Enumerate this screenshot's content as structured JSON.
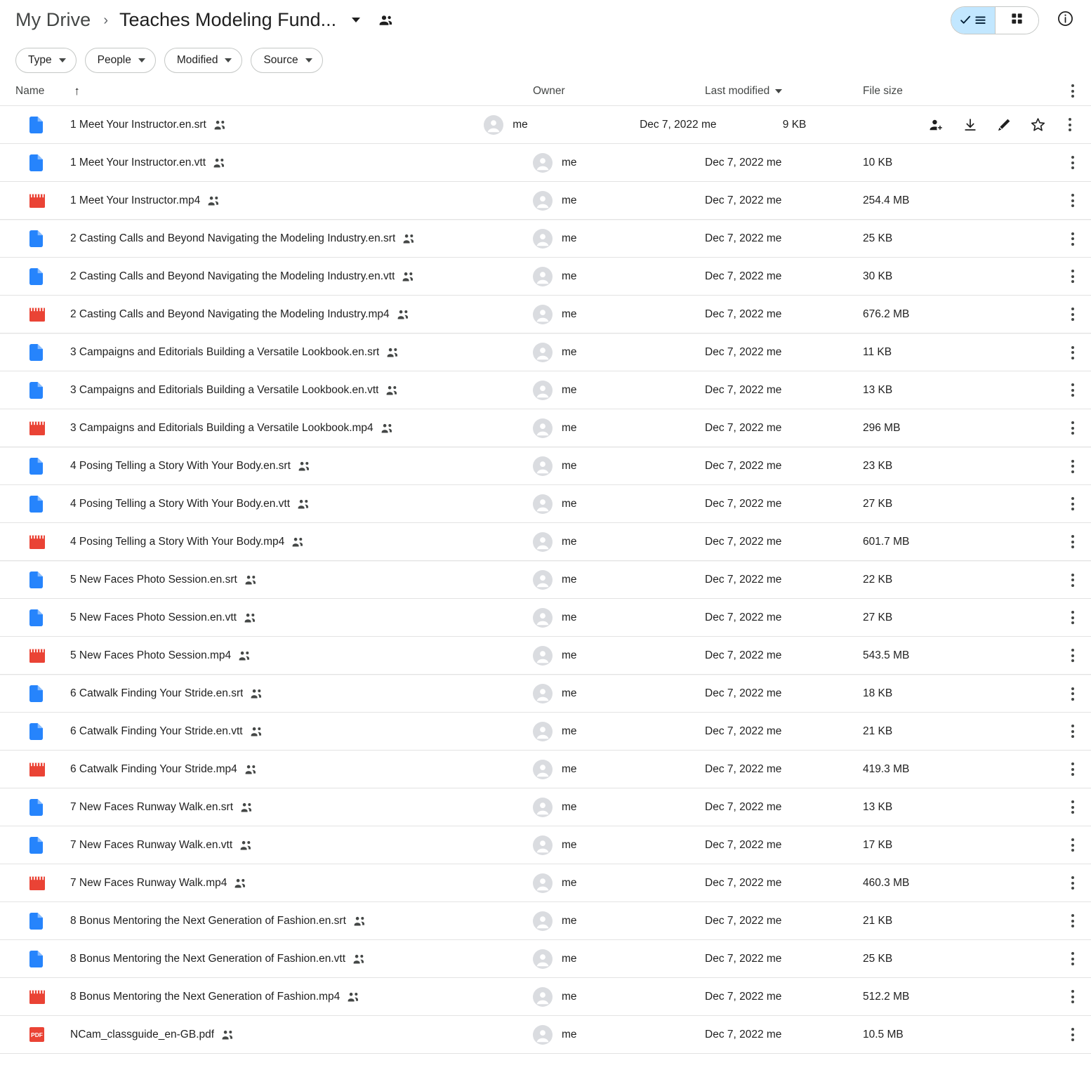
{
  "header": {
    "breadcrumb_root": "My Drive",
    "breadcrumb_separator": "›",
    "breadcrumb_current": "Teaches Modeling Fund...",
    "caret_icon": "chevron-down-icon",
    "shared_icon": "shared-folder-people-icon",
    "view_list_icon": "check-list-view-icon",
    "view_grid_icon": "grid-view-icon",
    "info_icon": "info-circle-icon",
    "active_view": "list",
    "accent_selected_bg": "#c2e7ff"
  },
  "filters": [
    {
      "label": "Type",
      "icon": "chevron-down-icon"
    },
    {
      "label": "People",
      "icon": "chevron-down-icon"
    },
    {
      "label": "Modified",
      "icon": "chevron-down-icon"
    },
    {
      "label": "Source",
      "icon": "chevron-down-icon"
    }
  ],
  "columns": {
    "name": "Name",
    "name_sort_icon": "↑",
    "owner": "Owner",
    "last_modified": "Last modified",
    "last_modified_sort_icon": "chevron-down-icon",
    "file_size": "File size",
    "more_icon": "more-vertical-icon"
  },
  "row_actions": {
    "share_icon": "person-add-icon",
    "download_icon": "download-icon",
    "edit_icon": "pencil-edit-icon",
    "star_icon": "star-outline-icon",
    "more_icon": "more-vertical-icon"
  },
  "file_type_colors": {
    "doc": "#2684fc",
    "video": "#ea4335",
    "pdf": "#ea4335"
  },
  "rows": [
    {
      "name": "1 Meet Your Instructor.en.srt",
      "type": "doc",
      "shared": true,
      "owner": "me",
      "modified": "Dec 7, 2022 me",
      "size": "9 KB",
      "hovered": true,
      "group_start": false
    },
    {
      "name": "1 Meet Your Instructor.en.vtt",
      "type": "doc",
      "shared": true,
      "owner": "me",
      "modified": "Dec 7, 2022 me",
      "size": "10 KB",
      "hovered": false,
      "group_start": false
    },
    {
      "name": "1 Meet Your Instructor.mp4",
      "type": "video",
      "shared": true,
      "owner": "me",
      "modified": "Dec 7, 2022 me",
      "size": "254.4 MB",
      "hovered": false,
      "group_start": false
    },
    {
      "name": "2 Casting Calls and Beyond Navigating the Modeling Industry.en.srt",
      "type": "doc",
      "shared": true,
      "owner": "me",
      "modified": "Dec 7, 2022 me",
      "size": "25 KB",
      "hovered": false,
      "group_start": true
    },
    {
      "name": "2 Casting Calls and Beyond Navigating the Modeling Industry.en.vtt",
      "type": "doc",
      "shared": true,
      "owner": "me",
      "modified": "Dec 7, 2022 me",
      "size": "30 KB",
      "hovered": false,
      "group_start": false
    },
    {
      "name": "2 Casting Calls and Beyond Navigating the Modeling Industry.mp4",
      "type": "video",
      "shared": true,
      "owner": "me",
      "modified": "Dec 7, 2022 me",
      "size": "676.2 MB",
      "hovered": false,
      "group_start": false
    },
    {
      "name": "3 Campaigns and Editorials Building a Versatile Lookbook.en.srt",
      "type": "doc",
      "shared": true,
      "owner": "me",
      "modified": "Dec 7, 2022 me",
      "size": "11 KB",
      "hovered": false,
      "group_start": true
    },
    {
      "name": "3 Campaigns and Editorials Building a Versatile Lookbook.en.vtt",
      "type": "doc",
      "shared": true,
      "owner": "me",
      "modified": "Dec 7, 2022 me",
      "size": "13 KB",
      "hovered": false,
      "group_start": false
    },
    {
      "name": "3 Campaigns and Editorials Building a Versatile Lookbook.mp4",
      "type": "video",
      "shared": true,
      "owner": "me",
      "modified": "Dec 7, 2022 me",
      "size": "296 MB",
      "hovered": false,
      "group_start": false
    },
    {
      "name": "4 Posing Telling a Story With Your Body.en.srt",
      "type": "doc",
      "shared": true,
      "owner": "me",
      "modified": "Dec 7, 2022 me",
      "size": "23 KB",
      "hovered": false,
      "group_start": true
    },
    {
      "name": "4 Posing Telling a Story With Your Body.en.vtt",
      "type": "doc",
      "shared": true,
      "owner": "me",
      "modified": "Dec 7, 2022 me",
      "size": "27 KB",
      "hovered": false,
      "group_start": false
    },
    {
      "name": "4 Posing Telling a Story With Your Body.mp4",
      "type": "video",
      "shared": true,
      "owner": "me",
      "modified": "Dec 7, 2022 me",
      "size": "601.7 MB",
      "hovered": false,
      "group_start": false
    },
    {
      "name": "5 New Faces Photo Session.en.srt",
      "type": "doc",
      "shared": true,
      "owner": "me",
      "modified": "Dec 7, 2022 me",
      "size": "22 KB",
      "hovered": false,
      "group_start": true
    },
    {
      "name": "5 New Faces Photo Session.en.vtt",
      "type": "doc",
      "shared": true,
      "owner": "me",
      "modified": "Dec 7, 2022 me",
      "size": "27 KB",
      "hovered": false,
      "group_start": false
    },
    {
      "name": "5 New Faces Photo Session.mp4",
      "type": "video",
      "shared": true,
      "owner": "me",
      "modified": "Dec 7, 2022 me",
      "size": "543.5 MB",
      "hovered": false,
      "group_start": false
    },
    {
      "name": "6 Catwalk Finding Your Stride.en.srt",
      "type": "doc",
      "shared": true,
      "owner": "me",
      "modified": "Dec 7, 2022 me",
      "size": "18 KB",
      "hovered": false,
      "group_start": true
    },
    {
      "name": "6 Catwalk Finding Your Stride.en.vtt",
      "type": "doc",
      "shared": true,
      "owner": "me",
      "modified": "Dec 7, 2022 me",
      "size": "21 KB",
      "hovered": false,
      "group_start": false
    },
    {
      "name": "6 Catwalk Finding Your Stride.mp4",
      "type": "video",
      "shared": true,
      "owner": "me",
      "modified": "Dec 7, 2022 me",
      "size": "419.3 MB",
      "hovered": false,
      "group_start": false
    },
    {
      "name": "7 New Faces Runway Walk.en.srt",
      "type": "doc",
      "shared": true,
      "owner": "me",
      "modified": "Dec 7, 2022 me",
      "size": "13 KB",
      "hovered": false,
      "group_start": false
    },
    {
      "name": "7 New Faces Runway Walk.en.vtt",
      "type": "doc",
      "shared": true,
      "owner": "me",
      "modified": "Dec 7, 2022 me",
      "size": "17 KB",
      "hovered": false,
      "group_start": false
    },
    {
      "name": "7 New Faces Runway Walk.mp4",
      "type": "video",
      "shared": true,
      "owner": "me",
      "modified": "Dec 7, 2022 me",
      "size": "460.3 MB",
      "hovered": false,
      "group_start": false
    },
    {
      "name": "8 Bonus Mentoring the Next Generation of Fashion.en.srt",
      "type": "doc",
      "shared": true,
      "owner": "me",
      "modified": "Dec 7, 2022 me",
      "size": "21 KB",
      "hovered": false,
      "group_start": false
    },
    {
      "name": "8 Bonus Mentoring the Next Generation of Fashion.en.vtt",
      "type": "doc",
      "shared": true,
      "owner": "me",
      "modified": "Dec 7, 2022 me",
      "size": "25 KB",
      "hovered": false,
      "group_start": false
    },
    {
      "name": "8 Bonus Mentoring the Next Generation of Fashion.mp4",
      "type": "video",
      "shared": true,
      "owner": "me",
      "modified": "Dec 7, 2022 me",
      "size": "512.2 MB",
      "hovered": false,
      "group_start": false
    },
    {
      "name": "NCam_classguide_en-GB.pdf",
      "type": "pdf",
      "shared": true,
      "owner": "me",
      "modified": "Dec 7, 2022 me",
      "size": "10.5 MB",
      "hovered": false,
      "group_start": false
    }
  ]
}
